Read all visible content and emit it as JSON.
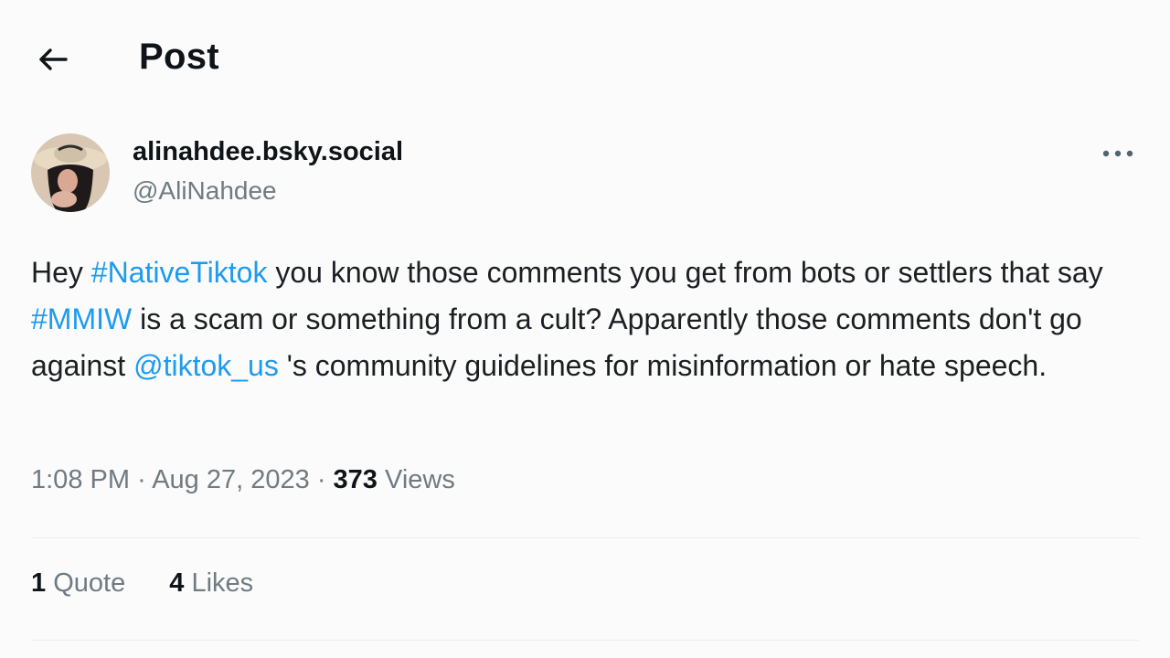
{
  "header": {
    "title": "Post",
    "back_icon": "arrow-left-icon"
  },
  "author": {
    "display_name": "alinahdee.bsky.social",
    "handle": "@AliNahdee",
    "more_icon": "more-horizontal-icon"
  },
  "post": {
    "segments": [
      {
        "type": "text",
        "value": "Hey "
      },
      {
        "type": "link",
        "value": "#NativeTiktok"
      },
      {
        "type": "text",
        "value": " you know those comments you get from bots or settlers that say "
      },
      {
        "type": "link",
        "value": "#MMIW"
      },
      {
        "type": "text",
        "value": " is a scam or something from a cult? Apparently those comments don't go against "
      },
      {
        "type": "link",
        "value": "@tiktok_us"
      },
      {
        "type": "text",
        "value": " 's community guidelines for misinformation or hate speech."
      }
    ]
  },
  "meta": {
    "time": "1:08 PM",
    "separator": "·",
    "date": "Aug 27, 2023",
    "views_count": "373",
    "views_label": "Views"
  },
  "stats": {
    "quotes_count": "1",
    "quotes_label": "Quote",
    "likes_count": "4",
    "likes_label": "Likes"
  },
  "colors": {
    "link": "#1d9bf0",
    "secondary_text": "#707a82",
    "primary_text": "#0f1419"
  }
}
